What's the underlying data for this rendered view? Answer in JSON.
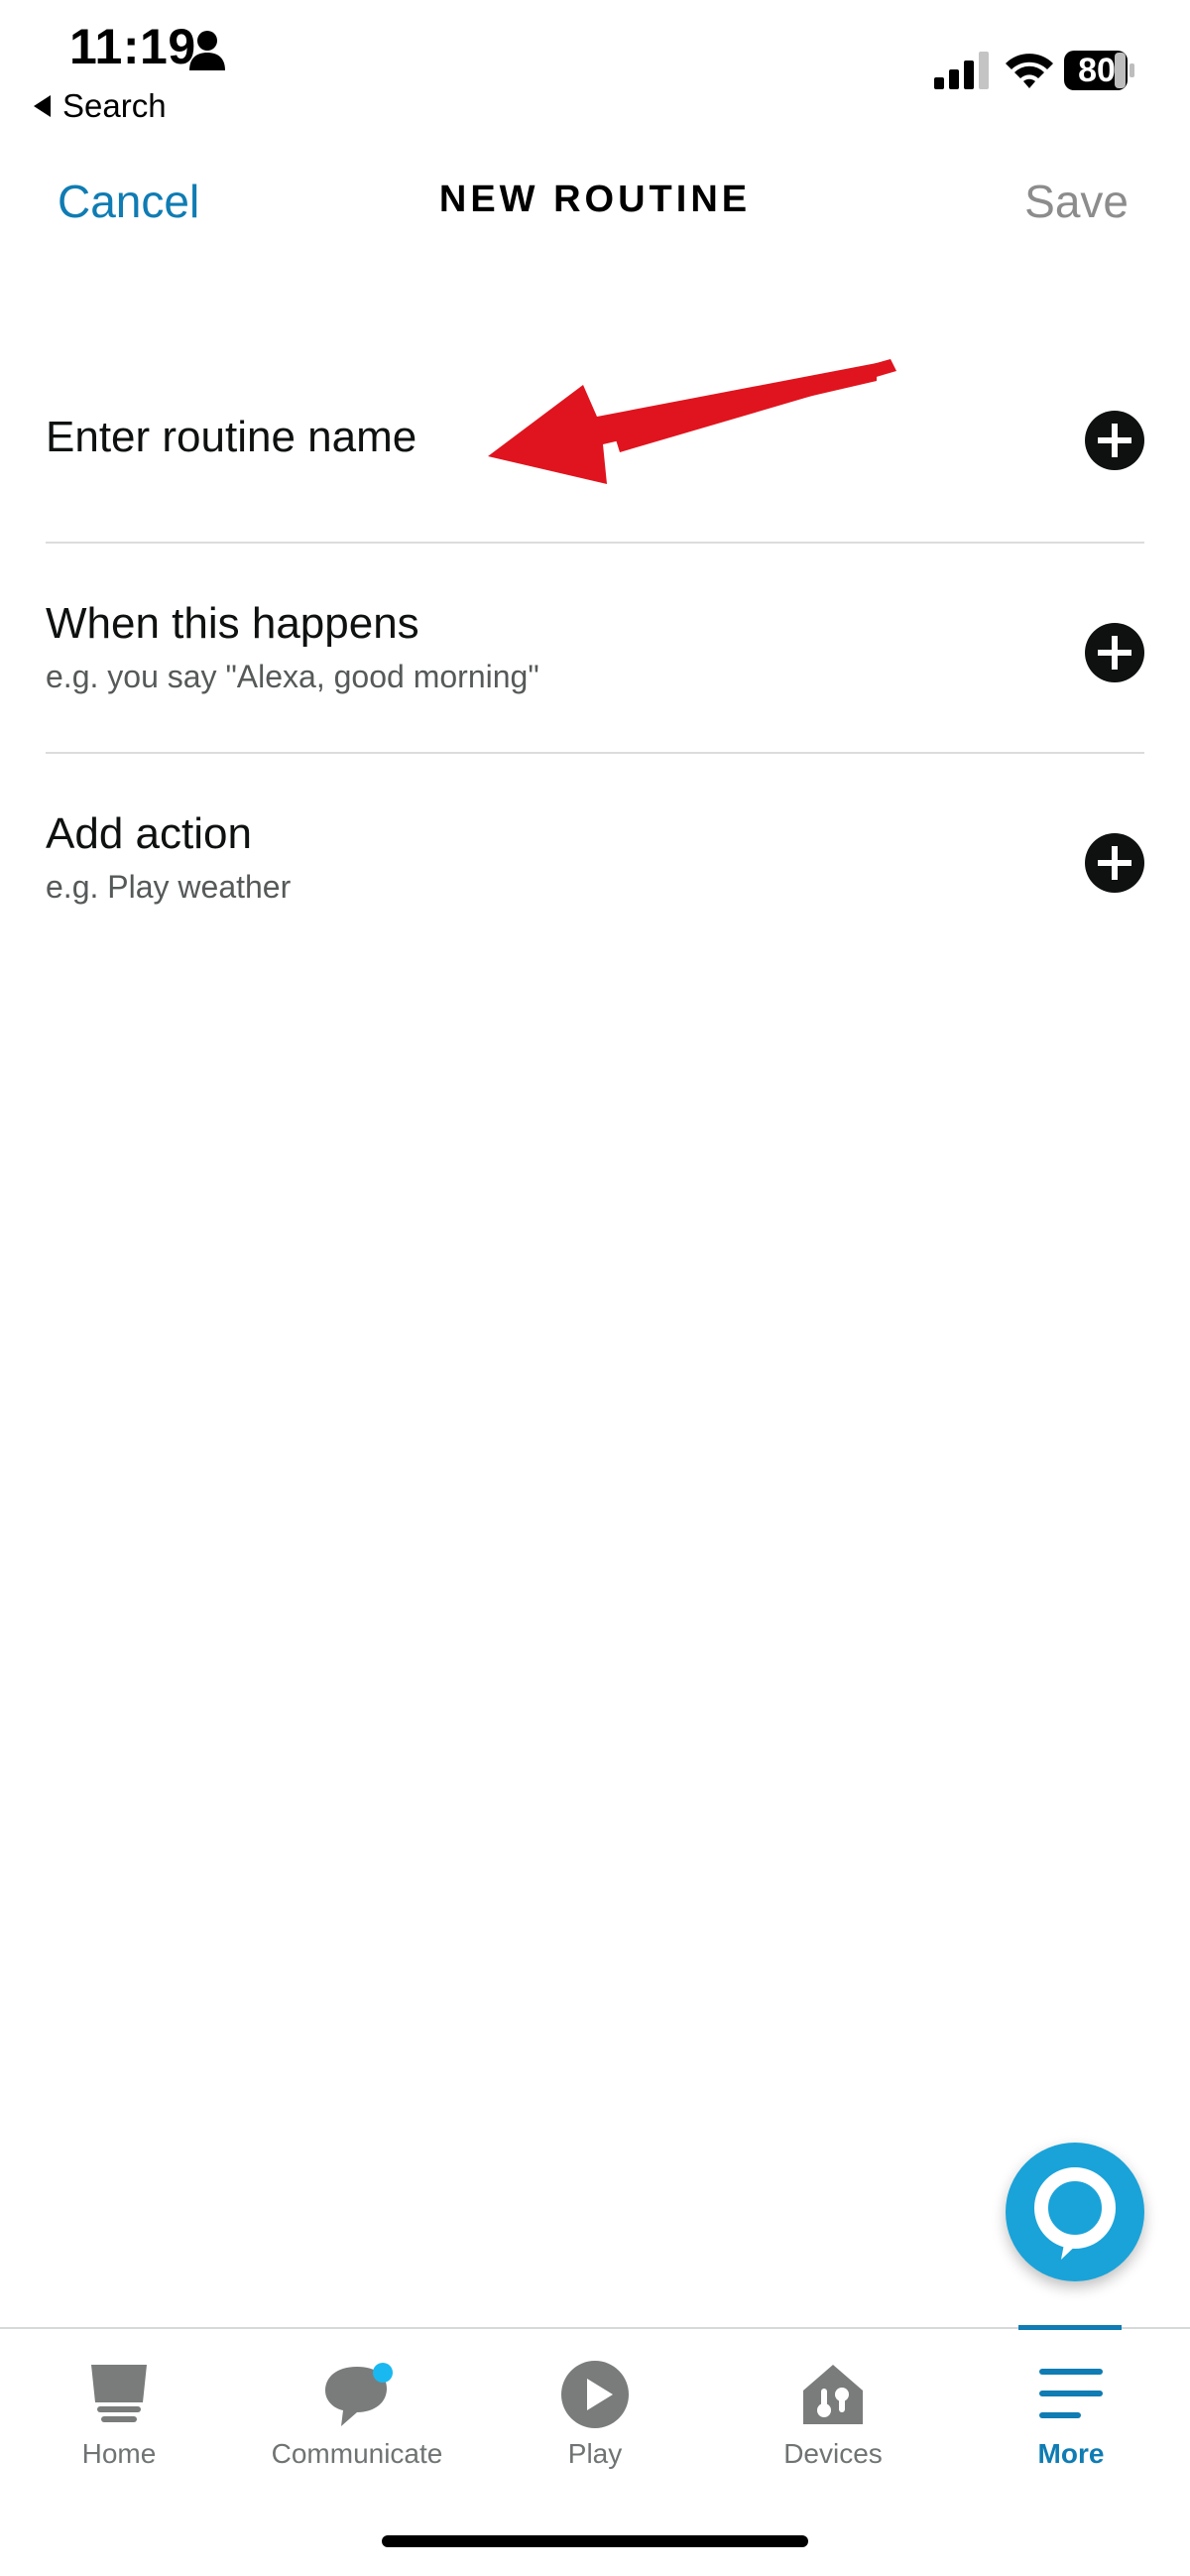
{
  "status_bar": {
    "time": "11:19",
    "back_label": "Search",
    "battery": "80"
  },
  "nav": {
    "cancel": "Cancel",
    "title": "NEW ROUTINE",
    "save": "Save"
  },
  "rows": [
    {
      "title": "Enter routine name",
      "subtitle": ""
    },
    {
      "title": "When this happens",
      "subtitle": "e.g. you say \"Alexa, good morning\""
    },
    {
      "title": "Add action",
      "subtitle": "e.g. Play weather"
    }
  ],
  "tabs": [
    {
      "label": "Home",
      "icon": "home-icon"
    },
    {
      "label": "Communicate",
      "icon": "communicate-icon"
    },
    {
      "label": "Play",
      "icon": "play-icon"
    },
    {
      "label": "Devices",
      "icon": "devices-icon"
    },
    {
      "label": "More",
      "icon": "more-icon",
      "active": true
    }
  ],
  "colors": {
    "accent": "#0f7cb3",
    "alexa": "#1aa3d9",
    "annotation_arrow": "#e0141e",
    "notification_dot": "#1ab8f0"
  }
}
